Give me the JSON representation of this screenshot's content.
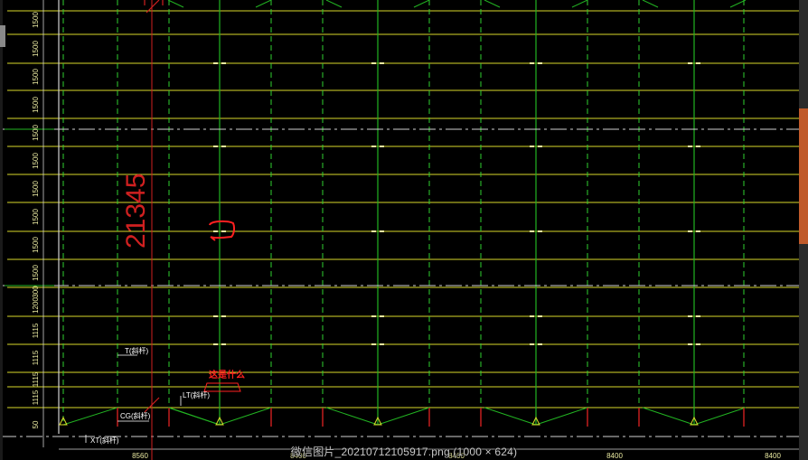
{
  "viewer": {
    "caption": "微信图片_20210712105917.png (1000 × 624)"
  },
  "drawing": {
    "row_labels": [
      "1500",
      "1500",
      "1500",
      "1500",
      "1500",
      "1500",
      "1500",
      "1500",
      "1500",
      "1500",
      "300",
      "1200",
      "1115",
      "1115",
      "1115",
      "1115",
      "50"
    ],
    "column_labels": [
      "8560",
      "8400",
      "8400",
      "8400",
      "8400"
    ],
    "dimension_text": "21345",
    "member_labels": {
      "t": "T(斜杆)",
      "cg": "CG(斜杆)",
      "lt": "LT(斜杆)",
      "xt": "XT(斜杆)"
    },
    "annotation_text": "这是什么",
    "colors": {
      "grid_yellow": "#d9d92a",
      "grid_green": "#22b322",
      "dash_green": "#2fd12f",
      "dim_red": "#d02020",
      "annotation_red": "#ff2020",
      "axis_white": "#d0d0d0",
      "tick_text": "#e8e8a0"
    }
  }
}
